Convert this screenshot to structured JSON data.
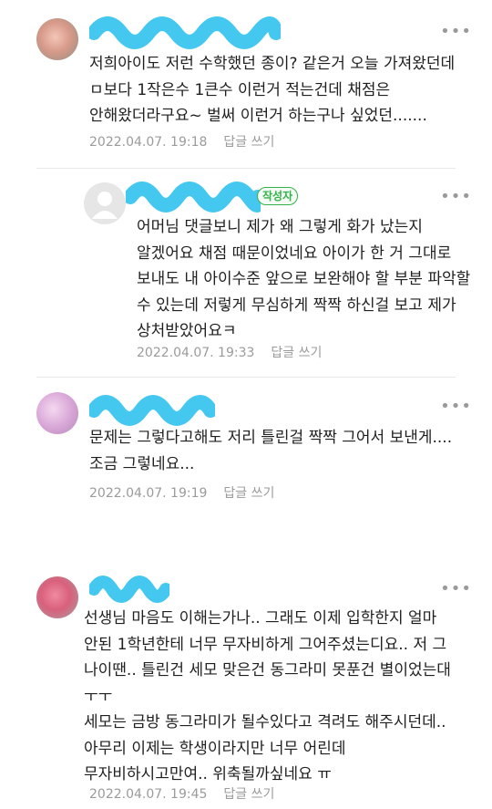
{
  "comments": [
    {
      "text": "저희아이도 저런 수학했던 종이? 같은거 오늘 가져왔던데\nㅁ보다 1작은수 1큰수 이런거 적는건데 채점은\n안해왔더라구요~ 벌써 이런거 하는구나 싶었던.......",
      "date": "2022.04.07. 19:18",
      "reply_label": "답글 쓰기"
    },
    {
      "badge": "작성자",
      "text": "어머님 댓글보니 제가 왜 그렇게 화가 났는지\n알겠어요 채점 때문이었네요 아이가 한 거 그대로\n보내도 내 아이수준 앞으로 보완해야 할 부분 파악할\n수 있는데 저렇게 무심하게 짝짝 하신걸 보고 제가\n상처받았어요ㅋ",
      "date": "2022.04.07. 19:33",
      "reply_label": "답글 쓰기"
    },
    {
      "text": "문제는 그렇다고해도 저리 틀린걸 짝짝 그어서 보낸게....\n조금 그렇네요...",
      "date": "2022.04.07. 19:19",
      "reply_label": "답글 쓰기"
    },
    {
      "text": "선생님 마음도 이해는가나.. 그래도 이제 입학한지 얼마\n안된 1학년한테 너무 무자비하게 그어주셨는디요.. 저 그\n나이땐.. 틀린건 세모 맞은건 동그라미 못푼건 별이었는대\nㅜㅜ\n세모는 금방 동그라미가 될수있다고 격려도 해주시던데..\n아무리 이제는 학생이라지만 너무 어린데\n무자비하시고만여.. 위축될까싶네요 ㅠ",
      "date": "2022.04.07. 19:45",
      "reply_label": "답글 쓰기"
    }
  ],
  "more_icon": "more-dots-icon",
  "colors": {
    "scribble": "#45c8f0",
    "badge": "#35b24a"
  }
}
